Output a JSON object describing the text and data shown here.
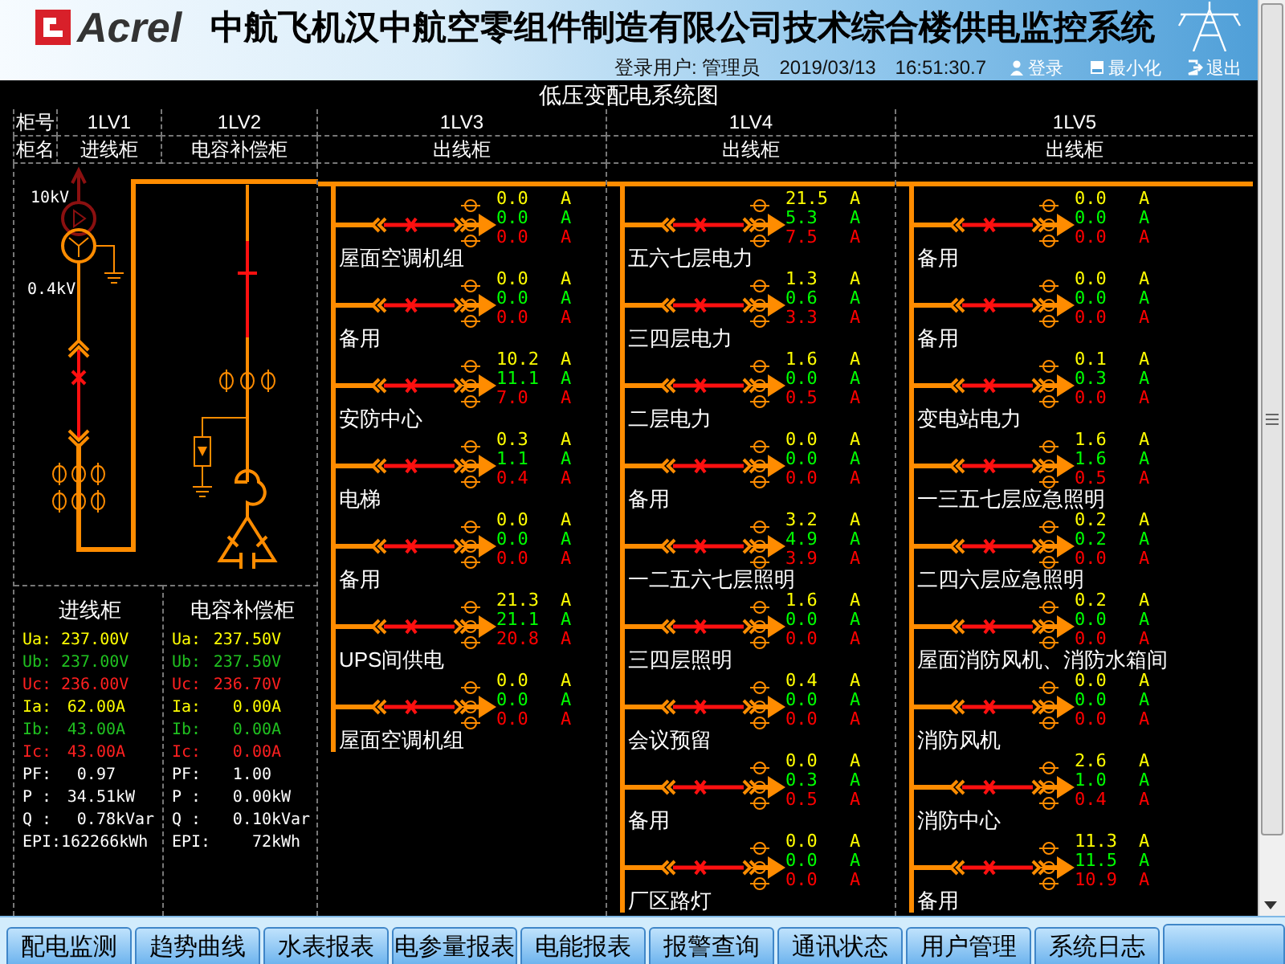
{
  "header": {
    "brand": "Acrel",
    "title": "中航飞机汉中航空零组件制造有限公司技术综合楼供电监控系统",
    "user_label": "登录用户:",
    "user": "管理员",
    "date": "2019/03/13",
    "time": "16:51:30.7",
    "actions": [
      {
        "kind": "login",
        "label": "登录"
      },
      {
        "kind": "minimize",
        "label": "最小化"
      },
      {
        "kind": "exit",
        "label": "退出"
      }
    ]
  },
  "diagram": {
    "title": "低压变配电系统图",
    "row_labels": [
      "柜号",
      "柜名"
    ],
    "cabinets": [
      {
        "number": "1LV1",
        "name": "进线柜"
      },
      {
        "number": "1LV2",
        "name": "电容补偿柜"
      },
      {
        "number": "1LV3",
        "name": "出线柜"
      },
      {
        "number": "1LV4",
        "name": "出线柜"
      },
      {
        "number": "1LV5",
        "name": "出线柜"
      }
    ],
    "voltages": [
      "10kV",
      "0.4kV"
    ],
    "panels": [
      {
        "title": "进线柜",
        "rows": [
          {
            "label": "Ua:",
            "value": "237.00",
            "unit": "V",
            "color": "#ffff00"
          },
          {
            "label": "Ub:",
            "value": "237.00",
            "unit": "V",
            "color": "#20c020"
          },
          {
            "label": "Uc:",
            "value": "236.00",
            "unit": "V",
            "color": "#ff2020"
          },
          {
            "label": "Ia:",
            "value": "62.00",
            "unit": "A",
            "color": "#ffff00"
          },
          {
            "label": "Ib:",
            "value": "43.00",
            "unit": "A",
            "color": "#20c020"
          },
          {
            "label": "Ic:",
            "value": "43.00",
            "unit": "A",
            "color": "#ff2020"
          },
          {
            "label": "PF:",
            "value": "0.97",
            "color": "#ffffff"
          },
          {
            "label": "P :",
            "value": "34.51",
            "unit": "kW",
            "color": "#ffffff"
          },
          {
            "label": "Q :",
            "value": "0.78",
            "unit": "kVar",
            "color": "#ffffff"
          },
          {
            "label": "EPI:",
            "value": "162266",
            "unit": "kWh",
            "color": "#ffffff"
          }
        ]
      },
      {
        "title": "电容补偿柜",
        "rows": [
          {
            "label": "Ua:",
            "value": "237.50",
            "unit": "V",
            "color": "#ffff00"
          },
          {
            "label": "Ub:",
            "value": "237.50",
            "unit": "V",
            "color": "#20c020"
          },
          {
            "label": "Uc:",
            "value": "236.70",
            "unit": "V",
            "color": "#ff2020"
          },
          {
            "label": "Ia:",
            "value": "0.00",
            "unit": "A",
            "color": "#ffff00"
          },
          {
            "label": "Ib:",
            "value": "0.00",
            "unit": "A",
            "color": "#20c020"
          },
          {
            "label": "Ic:",
            "value": "0.00",
            "unit": "A",
            "color": "#ff2020"
          },
          {
            "label": "PF:",
            "value": "1.00",
            "color": "#ffffff"
          },
          {
            "label": "P :",
            "value": "0.00",
            "unit": "kW",
            "color": "#ffffff"
          },
          {
            "label": "Q :",
            "value": "0.10",
            "unit": "kVar",
            "color": "#ffffff"
          },
          {
            "label": "EPI:",
            "value": "72",
            "unit": "kWh",
            "color": "#ffffff"
          }
        ]
      }
    ],
    "feeder_columns": [
      {
        "feeders": [
          {
            "label": "屋面空调机组",
            "readings": [
              {
                "value": "0.0",
                "unit": "A"
              },
              {
                "value": "0.0",
                "unit": "A"
              },
              {
                "value": "0.0",
                "unit": "A"
              }
            ]
          },
          {
            "label": "备用",
            "readings": [
              {
                "value": "0.0",
                "unit": "A"
              },
              {
                "value": "0.0",
                "unit": "A"
              },
              {
                "value": "0.0",
                "unit": "A"
              }
            ]
          },
          {
            "label": "安防中心",
            "readings": [
              {
                "value": "10.2",
                "unit": "A"
              },
              {
                "value": "11.1",
                "unit": "A"
              },
              {
                "value": "7.0",
                "unit": "A"
              }
            ]
          },
          {
            "label": "电梯",
            "readings": [
              {
                "value": "0.3",
                "unit": "A"
              },
              {
                "value": "1.1",
                "unit": "A"
              },
              {
                "value": "0.4",
                "unit": "A"
              }
            ]
          },
          {
            "label": "备用",
            "readings": [
              {
                "value": "0.0",
                "unit": "A"
              },
              {
                "value": "0.0",
                "unit": "A"
              },
              {
                "value": "0.0",
                "unit": "A"
              }
            ]
          },
          {
            "label": "UPS间供电",
            "readings": [
              {
                "value": "21.3",
                "unit": "A"
              },
              {
                "value": "21.1",
                "unit": "A"
              },
              {
                "value": "20.8",
                "unit": "A"
              }
            ]
          },
          {
            "label": "屋面空调机组",
            "readings": [
              {
                "value": "0.0",
                "unit": "A"
              },
              {
                "value": "0.0",
                "unit": "A"
              },
              {
                "value": "0.0",
                "unit": "A"
              }
            ]
          }
        ]
      },
      {
        "feeders": [
          {
            "label": "五六七层电力",
            "readings": [
              {
                "value": "21.5",
                "unit": "A"
              },
              {
                "value": "5.3",
                "unit": "A"
              },
              {
                "value": "7.5",
                "unit": "A"
              }
            ]
          },
          {
            "label": "三四层电力",
            "readings": [
              {
                "value": "1.3",
                "unit": "A"
              },
              {
                "value": "0.6",
                "unit": "A"
              },
              {
                "value": "3.3",
                "unit": "A"
              }
            ]
          },
          {
            "label": "二层电力",
            "readings": [
              {
                "value": "1.6",
                "unit": "A"
              },
              {
                "value": "0.0",
                "unit": "A"
              },
              {
                "value": "0.5",
                "unit": "A"
              }
            ]
          },
          {
            "label": "备用",
            "readings": [
              {
                "value": "0.0",
                "unit": "A"
              },
              {
                "value": "0.0",
                "unit": "A"
              },
              {
                "value": "0.0",
                "unit": "A"
              }
            ]
          },
          {
            "label": "一二五六七层照明",
            "readings": [
              {
                "value": "3.2",
                "unit": "A"
              },
              {
                "value": "4.9",
                "unit": "A"
              },
              {
                "value": "3.9",
                "unit": "A"
              }
            ]
          },
          {
            "label": "三四层照明",
            "readings": [
              {
                "value": "1.6",
                "unit": "A"
              },
              {
                "value": "0.0",
                "unit": "A"
              },
              {
                "value": "0.0",
                "unit": "A"
              }
            ]
          },
          {
            "label": "会议预留",
            "readings": [
              {
                "value": "0.4",
                "unit": "A"
              },
              {
                "value": "0.0",
                "unit": "A"
              },
              {
                "value": "0.0",
                "unit": "A"
              }
            ]
          },
          {
            "label": "备用",
            "readings": [
              {
                "value": "0.0",
                "unit": "A"
              },
              {
                "value": "0.3",
                "unit": "A"
              },
              {
                "value": "0.5",
                "unit": "A"
              }
            ]
          },
          {
            "label": "厂区路灯",
            "readings": [
              {
                "value": "0.0",
                "unit": "A"
              },
              {
                "value": "0.0",
                "unit": "A"
              },
              {
                "value": "0.0",
                "unit": "A"
              }
            ]
          }
        ]
      },
      {
        "feeders": [
          {
            "label": "备用",
            "readings": [
              {
                "value": "0.0",
                "unit": "A"
              },
              {
                "value": "0.0",
                "unit": "A"
              },
              {
                "value": "0.0",
                "unit": "A"
              }
            ]
          },
          {
            "label": "备用",
            "readings": [
              {
                "value": "0.0",
                "unit": "A"
              },
              {
                "value": "0.0",
                "unit": "A"
              },
              {
                "value": "0.0",
                "unit": "A"
              }
            ]
          },
          {
            "label": "变电站电力",
            "readings": [
              {
                "value": "0.1",
                "unit": "A"
              },
              {
                "value": "0.3",
                "unit": "A"
              },
              {
                "value": "0.0",
                "unit": "A"
              }
            ]
          },
          {
            "label": "一三五七层应急照明",
            "readings": [
              {
                "value": "1.6",
                "unit": "A"
              },
              {
                "value": "1.6",
                "unit": "A"
              },
              {
                "value": "0.5",
                "unit": "A"
              }
            ]
          },
          {
            "label": "二四六层应急照明",
            "readings": [
              {
                "value": "0.2",
                "unit": "A"
              },
              {
                "value": "0.2",
                "unit": "A"
              },
              {
                "value": "0.0",
                "unit": "A"
              }
            ]
          },
          {
            "label": "屋面消防风机、消防水箱间",
            "readings": [
              {
                "value": "0.2",
                "unit": "A"
              },
              {
                "value": "0.0",
                "unit": "A"
              },
              {
                "value": "0.0",
                "unit": "A"
              }
            ]
          },
          {
            "label": "消防风机",
            "readings": [
              {
                "value": "0.0",
                "unit": "A"
              },
              {
                "value": "0.0",
                "unit": "A"
              },
              {
                "value": "0.0",
                "unit": "A"
              }
            ]
          },
          {
            "label": "消防中心",
            "readings": [
              {
                "value": "2.6",
                "unit": "A"
              },
              {
                "value": "1.0",
                "unit": "A"
              },
              {
                "value": "0.4",
                "unit": "A"
              }
            ]
          },
          {
            "label": "备用",
            "readings": [
              {
                "value": "11.3",
                "unit": "A"
              },
              {
                "value": "11.5",
                "unit": "A"
              },
              {
                "value": "10.9",
                "unit": "A"
              }
            ]
          }
        ]
      }
    ]
  },
  "nav": [
    {
      "label": "配电监测",
      "selected": false
    },
    {
      "label": "趋势曲线",
      "selected": false
    },
    {
      "label": "水表报表",
      "selected": false
    },
    {
      "label": "电参量报表",
      "selected": false
    },
    {
      "label": "电能报表",
      "selected": false
    },
    {
      "label": "报警查询",
      "selected": false
    },
    {
      "label": "通讯状态",
      "selected": false
    },
    {
      "label": "用户管理",
      "selected": false
    },
    {
      "label": "系统日志",
      "selected": false
    }
  ]
}
